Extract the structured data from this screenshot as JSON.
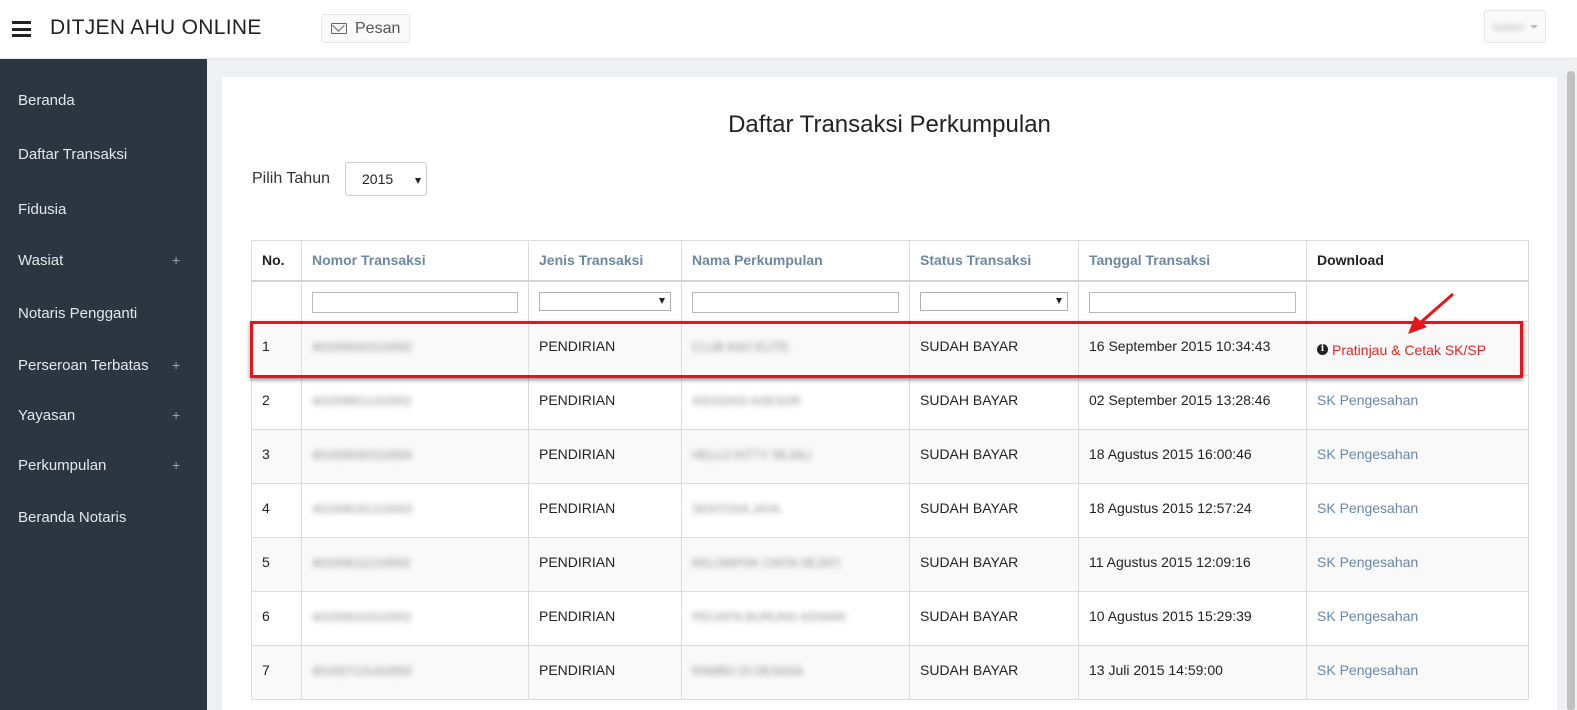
{
  "app": {
    "brand": "DITJEN AHU ONLINE",
    "pesan_label": "Pesan",
    "user_name": "Isaten"
  },
  "sidebar": {
    "items": [
      {
        "label": "Beranda",
        "expandable": false
      },
      {
        "label": "Daftar Transaksi",
        "expandable": false
      },
      {
        "label": "Fidusia",
        "expandable": false
      },
      {
        "label": "Wasiat",
        "expandable": true
      },
      {
        "label": "Notaris Pengganti",
        "expandable": false
      },
      {
        "label": "Perseroan Terbatas",
        "expandable": true
      },
      {
        "label": "Yayasan",
        "expandable": true
      },
      {
        "label": "Perkumpulan",
        "expandable": true
      },
      {
        "label": "Beranda Notaris",
        "expandable": false
      }
    ],
    "plus_glyph": "+"
  },
  "main": {
    "title": "Daftar Transaksi Perkumpulan",
    "year_label": "Pilih Tahun",
    "year_value": "2015"
  },
  "table": {
    "columns": [
      "No.",
      "Nomor Transaksi",
      "Jenis Transaksi",
      "Nama Perkumpulan",
      "Status Transaksi",
      "Tanggal Transaksi",
      "Download"
    ],
    "rows": [
      {
        "no": "1",
        "nomor": "401509161510002",
        "jenis": "PENDIRIAN",
        "nama": "CLUB ASO ELITE",
        "status": "SUDAH BAYAR",
        "tanggal": "16 September 2015 10:34:43",
        "download": "Pratinjau & Cetak SK/SP"
      },
      {
        "no": "2",
        "nomor": "401509021310001",
        "jenis": "PENDIRIAN",
        "nama": "ASOSIASI ASESOR",
        "status": "SUDAH BAYAR",
        "tanggal": "02 September 2015 13:28:46",
        "download": "SK Pengesahan"
      },
      {
        "no": "3",
        "nomor": "401508181510004",
        "jenis": "PENDIRIAN",
        "nama": "HELLO KITTY SEJALI",
        "status": "SUDAH BAYAR",
        "tanggal": "18 Agustus 2015 16:00:46",
        "download": "SK Pengesahan"
      },
      {
        "no": "4",
        "nomor": "401508181210003",
        "jenis": "PENDIRIAN",
        "nama": "SENTOSA JAYA",
        "status": "SUDAH BAYAR",
        "tanggal": "18 Agustus 2015 12:57:24",
        "download": "SK Pengesahan"
      },
      {
        "no": "5",
        "nomor": "401508111210002",
        "jenis": "PENDIRIAN",
        "nama": "KELOMPOK CINTA SEJATI",
        "status": "SUDAH BAYAR",
        "tanggal": "11 Agustus 2015 12:09:16",
        "download": "SK Pengesahan"
      },
      {
        "no": "6",
        "nomor": "401508101510001",
        "jenis": "PENDIRIAN",
        "nama": "PECINTA BURUNG KENARI",
        "status": "SUDAH BAYAR",
        "tanggal": "10 Agustus 2015 15:29:39",
        "download": "SK Pengesahan"
      },
      {
        "no": "7",
        "nomor": "401507131410002",
        "jenis": "PENDIRIAN",
        "nama": "RAMBO DI DESASA",
        "status": "SUDAH BAYAR",
        "tanggal": "13 Juli 2015 14:59:00",
        "download": "SK Pengesahan"
      }
    ]
  },
  "colors": {
    "sidebar_bg": "#2b3640",
    "header_link": "#6d87a2",
    "status_green": "#2e8a2e",
    "highlight_red": "#e4161b",
    "download_red": "#e32424"
  }
}
